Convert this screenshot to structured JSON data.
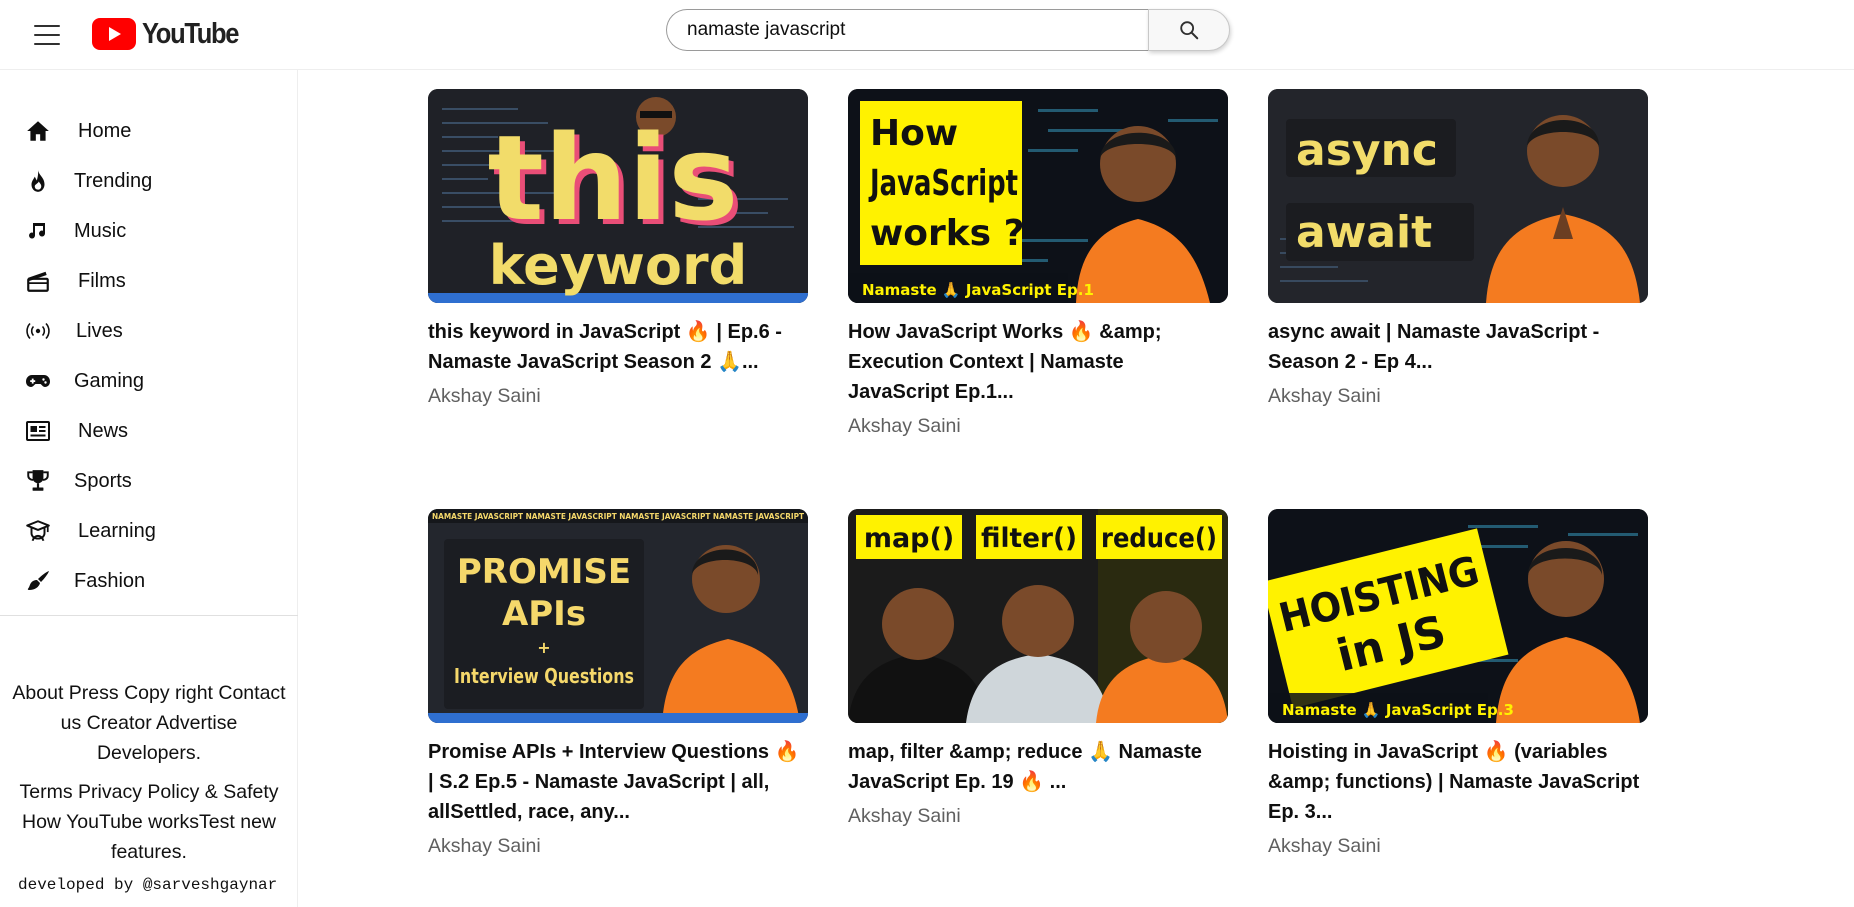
{
  "header": {
    "logo_text": "YouTube",
    "search": {
      "value": "namaste javascript",
      "placeholder": "Search"
    }
  },
  "sidebar": {
    "items": [
      {
        "label": "Home",
        "icon": "home-icon"
      },
      {
        "label": "Trending",
        "icon": "fire-icon"
      },
      {
        "label": "Music",
        "icon": "music-note-icon"
      },
      {
        "label": "Films",
        "icon": "clapperboard-icon"
      },
      {
        "label": "Lives",
        "icon": "live-broadcast-icon"
      },
      {
        "label": "Gaming",
        "icon": "gamepad-icon"
      },
      {
        "label": "News",
        "icon": "newspaper-icon"
      },
      {
        "label": "Sports",
        "icon": "trophy-icon"
      },
      {
        "label": "Learning",
        "icon": "graduation-cap-icon"
      },
      {
        "label": "Fashion",
        "icon": "hanger-brush-icon"
      }
    ],
    "footer": {
      "links_1": [
        "About",
        "Press",
        "Copy right",
        "Contact us",
        "Creator",
        "Advertise",
        "Developers."
      ],
      "links_2": [
        "Terms",
        "Privacy Policy & Safety",
        "How YouTube works",
        "Test new features."
      ]
    },
    "credit": "developed by @sarveshgaynar"
  },
  "videos": [
    {
      "title": "this keyword in JavaScript 🔥 | Ep.6 - Namaste JavaScript Season 2 🙏...",
      "channel": "Akshay Saini",
      "thumb": {
        "lines": [
          "this",
          "keyword"
        ],
        "colors": [
          "#f2dc6a",
          "#1f2127",
          "#e94e77"
        ]
      }
    },
    {
      "title": "How JavaScript Works 🔥 &amp; Execution Context | Namaste JavaScript Ep.1...",
      "channel": "Akshay Saini",
      "thumb": {
        "lines": [
          "How",
          "JavaScript",
          "works ?"
        ],
        "badge": "Namaste 🙏 JavaScript Ep.1",
        "colors": [
          "#fff200",
          "#0d1118",
          "#f47b20"
        ]
      }
    },
    {
      "title": "async await | Namaste JavaScript - Season 2 - Ep 4...",
      "channel": "Akshay Saini",
      "thumb": {
        "lines": [
          "async",
          "await"
        ],
        "colors": [
          "#f2dc6a",
          "#23252b",
          "#f47b20"
        ]
      }
    },
    {
      "title": "Promise APIs + Interview Questions 🔥 | S.2 Ep.5 - Namaste JavaScript | all, allSettled, race, any...",
      "channel": "Akshay Saini",
      "thumb": {
        "lines": [
          "PROMISE",
          "APIs",
          "+",
          "Interview Questions"
        ],
        "banner": "NAMASTE JAVASCRIPT NAMASTE JAVASCRIPT NAMASTE JAVASCRIPT NAMASTE JAVASCRIPT",
        "colors": [
          "#f5d86b",
          "#23262d",
          "#f47b20"
        ]
      }
    },
    {
      "title": "map, filter &amp; reduce 🙏 Namaste JavaScript Ep. 19 🔥 ...",
      "channel": "Akshay Saini",
      "thumb": {
        "lines": [
          "map()",
          "filter()",
          "reduce()"
        ],
        "colors": [
          "#fff200",
          "#1b1b1b",
          "#f47b20"
        ]
      }
    },
    {
      "title": "Hoisting in JavaScript 🔥 (variables &amp; functions) | Namaste JavaScript Ep. 3...",
      "channel": "Akshay Saini",
      "thumb": {
        "lines": [
          "HOISTING",
          "in JS"
        ],
        "badge": "Namaste 🙏 JavaScript Ep.3",
        "colors": [
          "#fff200",
          "#0d1118",
          "#f47b20"
        ]
      }
    }
  ]
}
